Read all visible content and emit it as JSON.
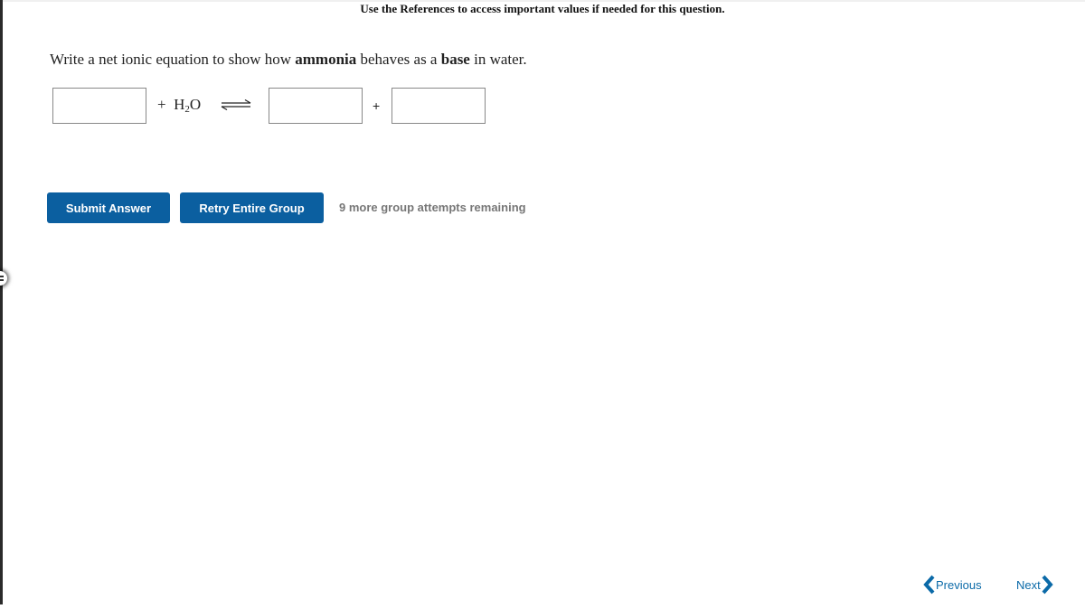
{
  "header": {
    "references_text": "Use the References to access important values if needed for this question."
  },
  "question": {
    "prefix": "Write a net ionic equation to show how ",
    "bold1": "ammonia",
    "middle": " behaves as a ",
    "bold2": "base",
    "suffix": " in water."
  },
  "equation": {
    "reactant1_value": "",
    "plus1": "+",
    "water_H": "H",
    "water_sub": "2",
    "water_O": "O",
    "arrow_icon": "equilibrium-arrows-icon",
    "product1_value": "",
    "plus2": "+",
    "product2_value": ""
  },
  "actions": {
    "submit_label": "Submit Answer",
    "retry_label": "Retry Entire Group",
    "attempts_text": "9 more group attempts remaining"
  },
  "navigation": {
    "previous_label": "Previous",
    "next_label": "Next"
  },
  "colors": {
    "button_bg": "#0b5fa0",
    "nav_link": "#0b6aa8",
    "attempts_text": "#777777"
  }
}
